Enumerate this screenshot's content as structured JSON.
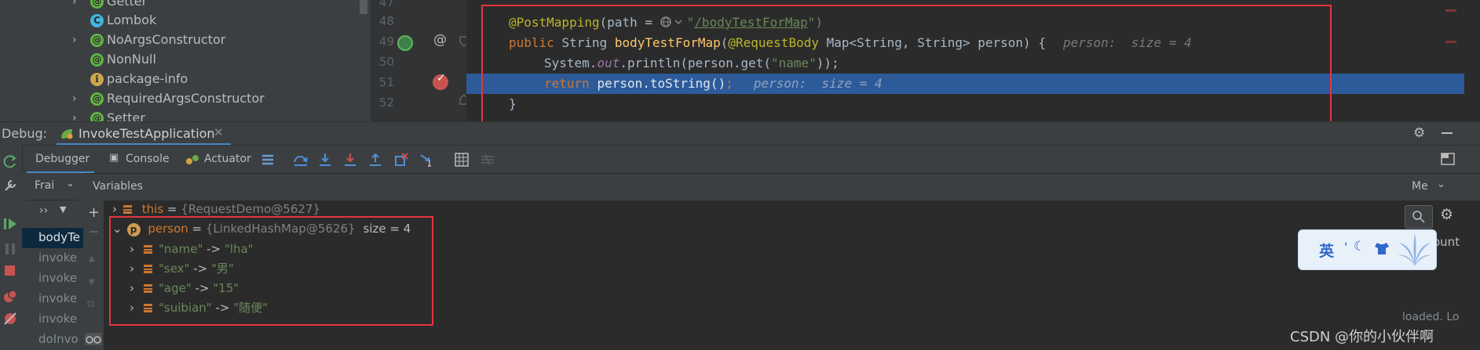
{
  "project_tree": {
    "items": [
      {
        "label": "Getter",
        "icon": "annotation-icon",
        "icon_char": "@",
        "expandable": true
      },
      {
        "label": "Lombok",
        "icon": "class-icon",
        "icon_char": "C",
        "expandable": false
      },
      {
        "label": "NoArgsConstructor",
        "icon": "annotation-icon",
        "icon_char": "@",
        "expandable": true
      },
      {
        "label": "NonNull",
        "icon": "annotation-icon",
        "icon_char": "@",
        "expandable": false
      },
      {
        "label": "package-info",
        "icon": "info-icon",
        "icon_char": "i",
        "expandable": false
      },
      {
        "label": "RequiredArgsConstructor",
        "icon": "annotation-icon",
        "icon_char": "@",
        "expandable": true
      },
      {
        "label": "Setter",
        "icon": "annotation-icon",
        "icon_char": "@",
        "expandable": true
      }
    ]
  },
  "editor": {
    "line_numbers": [
      "47",
      "48",
      "49",
      "50",
      "51",
      "52"
    ],
    "lines": {
      "l48": {
        "annotation": "@PostMapping",
        "open": "(path = ",
        "quote_open": "\"",
        "url": "/bodyTestForMap",
        "quote_close": "\")"
      },
      "l49": {
        "kw_public": "public ",
        "type": "String ",
        "method": "bodyTestForMap",
        "paren": "(",
        "annotation": "@RequestBody",
        "params": " Map<String, String> person) {",
        "hint": "person:  size = 4"
      },
      "l50": {
        "prefix": "System.",
        "out": "out",
        "mid": ".println(person.get(",
        "str": "\"name\"",
        "suffix": "));"
      },
      "l51": {
        "kw_return": "return ",
        "expr": "person.toString()",
        "semi": ";",
        "hint": "person:  size = 4"
      },
      "l52": {
        "brace": "}"
      }
    }
  },
  "debug": {
    "title": "Debug:",
    "tab_label": "InvokeTestApplication",
    "toolbar": {
      "debugger": "Debugger",
      "console": "Console",
      "actuator": "Actuator"
    },
    "frames_label": "Frai",
    "variables_label": "Variables",
    "memory_label": "Me",
    "frames": [
      "bodyTe",
      "invoke",
      "invoke",
      "invoke",
      "invoke",
      "doInvo"
    ],
    "variables": {
      "this_row": {
        "name": "this",
        "eq": " = ",
        "value": "{RequestDemo@5627}"
      },
      "person_row": {
        "name": "person",
        "eq": " = ",
        "value": "{LinkedHashMap@5626}",
        "size": "size = 4"
      },
      "entries": [
        {
          "key": "\"name\"",
          "arrow": " -> ",
          "value": "\"lha\""
        },
        {
          "key": "\"sex\"",
          "arrow": " -> ",
          "value": "\"男\""
        },
        {
          "key": "\"age\"",
          "arrow": " -> ",
          "value": "\"15\""
        },
        {
          "key": "\"suibian\"",
          "arrow": " -> ",
          "value": "\"随便\""
        }
      ]
    },
    "right_partial": "ount",
    "loaded_text": "loaded. Lo"
  },
  "ime": {
    "label": "英",
    "symbols": "' ) "
  },
  "watermark": "CSDN @你的小伙伴啊",
  "colors": {
    "highlight": "#2d5b9a",
    "red_box": "#e2363f"
  }
}
